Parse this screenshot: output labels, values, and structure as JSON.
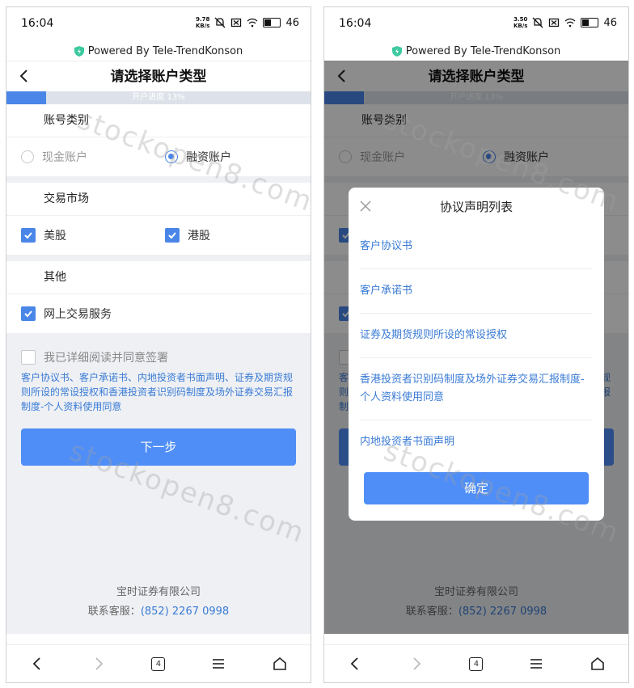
{
  "status_bar": {
    "left": {
      "time": "16:04",
      "net_value": "9.78",
      "net_unit": "KB/s",
      "battery": "46"
    },
    "right": {
      "time": "16:04",
      "net_value": "3.50",
      "net_unit": "KB/s",
      "battery": "46"
    }
  },
  "powered_by": "Powered By Tele-TrendKonson",
  "header": {
    "title": "请选择账户类型"
  },
  "progress": {
    "label": "开户进度 13%",
    "value": 0.13
  },
  "account_type": {
    "heading": "账号类别",
    "options": [
      {
        "label": "现金账户",
        "selected": false
      },
      {
        "label": "融资账户",
        "selected": true
      }
    ]
  },
  "market": {
    "heading": "交易市场",
    "options": [
      {
        "label": "美股",
        "checked": true
      },
      {
        "label": "港股",
        "checked": true
      }
    ]
  },
  "other": {
    "heading": "其他",
    "options": [
      {
        "label": "网上交易服务",
        "checked": true
      }
    ]
  },
  "agreement": {
    "checkbox_label": "我已详细阅读并同意签署",
    "links_text": "客户协议书、客户承诺书、内地投资者书面声明、证券及期货规则所设的常设授权和香港投资者识别码制度及场外证券交易汇报制度-个人资料使用同意"
  },
  "next_button": "下一步",
  "footer": {
    "company": "宝时证券有限公司",
    "contact_label": "联系客服：",
    "phone": "(852) 2267 0998"
  },
  "watermark": "stockopen8.com",
  "nav": {
    "tabs_count": "4"
  },
  "modal": {
    "title": "协议声明列表",
    "items": [
      "客户协议书",
      "客户承诺书",
      "证券及期货规则所设的常设授权",
      "香港投资者识别码制度及场外证券交易汇报制度-个人资料使用同意",
      "内地投资者书面声明"
    ],
    "confirm": "确定"
  },
  "colors": {
    "accent": "#4a86e8",
    "button": "#4f8ef7",
    "link": "#3a7bd5"
  }
}
